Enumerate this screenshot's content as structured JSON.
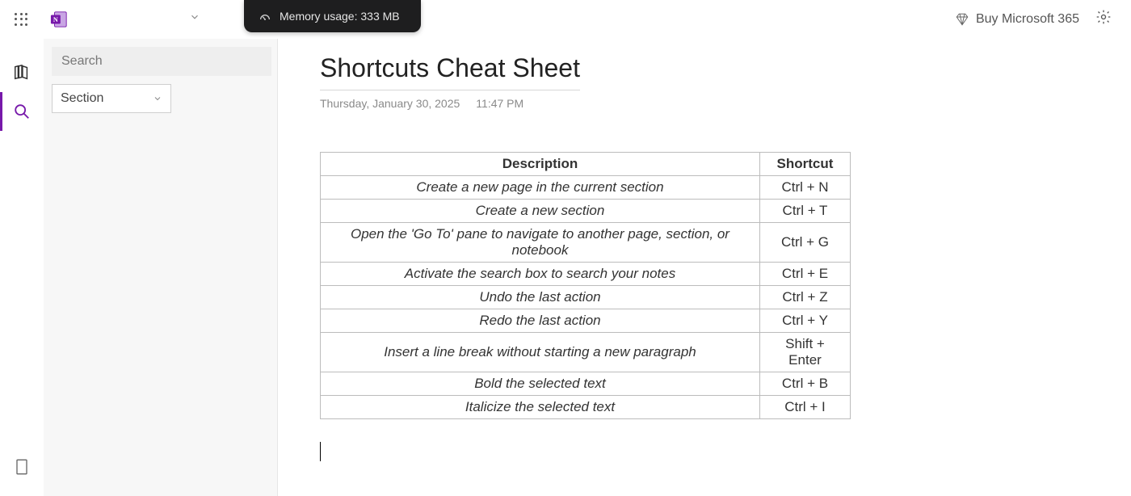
{
  "header": {
    "memory_label": "Memory usage: 333 MB",
    "buy_label": "Buy Microsoft 365"
  },
  "sidebar": {
    "search_placeholder": "Search",
    "section_label": "Section"
  },
  "page": {
    "title": "Shortcuts Cheat Sheet",
    "date": "Thursday, January 30, 2025",
    "time": "11:47 PM"
  },
  "table": {
    "headers": {
      "description": "Description",
      "shortcut": "Shortcut"
    },
    "rows": [
      {
        "description": "Create a new page in the current section",
        "shortcut": "Ctrl + N"
      },
      {
        "description": "Create a new section",
        "shortcut": "Ctrl + T"
      },
      {
        "description": "Open the 'Go To' pane to navigate to another page, section, or notebook",
        "shortcut": "Ctrl + G"
      },
      {
        "description": "Activate the search box to search your notes",
        "shortcut": "Ctrl + E"
      },
      {
        "description": "Undo the last action",
        "shortcut": "Ctrl + Z"
      },
      {
        "description": "Redo the last action",
        "shortcut": "Ctrl + Y"
      },
      {
        "description": "Insert a line break without starting a new paragraph",
        "shortcut": "Shift + Enter"
      },
      {
        "description": "Bold the selected text",
        "shortcut": "Ctrl + B"
      },
      {
        "description": "Italicize the selected text",
        "shortcut": "Ctrl + I"
      }
    ]
  }
}
